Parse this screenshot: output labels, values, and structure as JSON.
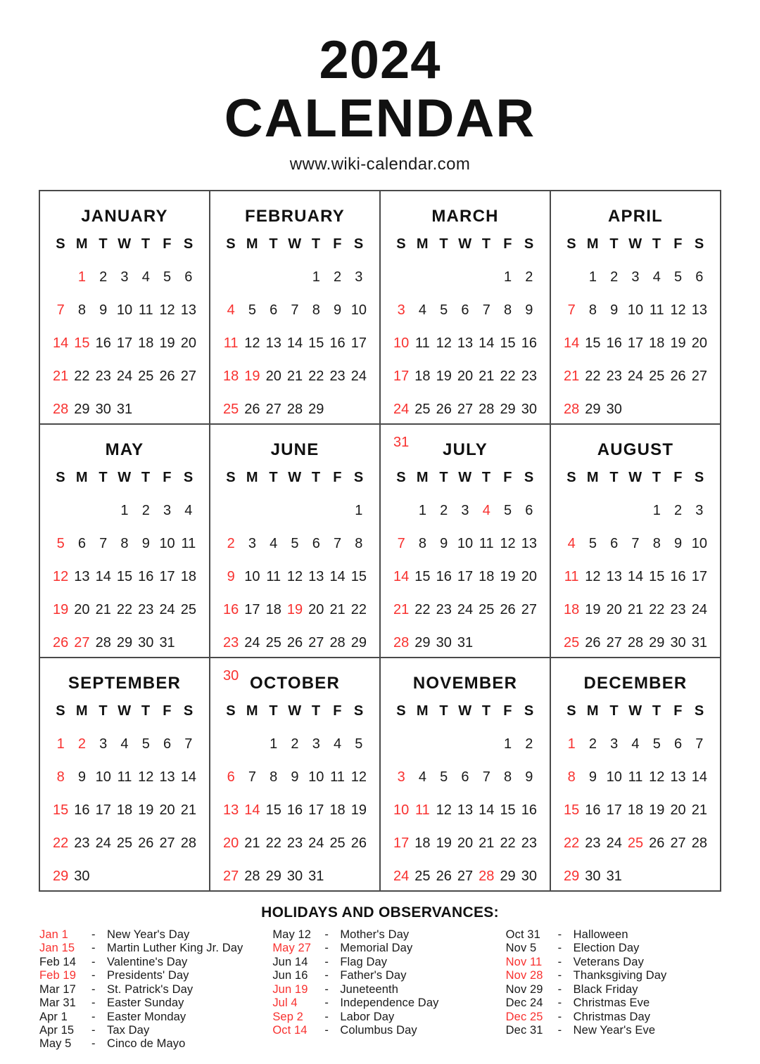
{
  "header": {
    "year": "2024",
    "word": "CALENDAR",
    "site": "www.wiki-calendar.com"
  },
  "colors": {
    "accent_red": "#f8312f",
    "text_black": "#1a1a1a",
    "border": "#4a4a4a"
  },
  "weekday_initials": [
    "S",
    "M",
    "T",
    "W",
    "T",
    "F",
    "S"
  ],
  "chart_data": {
    "type": "table",
    "title": "2024 CALENDAR",
    "months": [
      {
        "name": "JANUARY",
        "lead_blanks": 1,
        "days": 31,
        "red_days": [
          1,
          7,
          14,
          15,
          21,
          28
        ]
      },
      {
        "name": "FEBRUARY",
        "lead_blanks": 4,
        "days": 29,
        "red_days": [
          4,
          11,
          18,
          19,
          25
        ]
      },
      {
        "name": "MARCH",
        "lead_blanks": 5,
        "days": 31,
        "red_days": [
          3,
          10,
          17,
          24,
          31
        ]
      },
      {
        "name": "APRIL",
        "lead_blanks": 1,
        "days": 30,
        "red_days": [
          7,
          14,
          21,
          28
        ]
      },
      {
        "name": "MAY",
        "lead_blanks": 3,
        "days": 31,
        "red_days": [
          5,
          12,
          19,
          26,
          27
        ]
      },
      {
        "name": "JUNE",
        "lead_blanks": 6,
        "days": 30,
        "red_days": [
          2,
          9,
          16,
          19,
          23,
          30
        ]
      },
      {
        "name": "JULY",
        "lead_blanks": 1,
        "days": 31,
        "red_days": [
          4,
          7,
          14,
          21,
          28
        ]
      },
      {
        "name": "AUGUST",
        "lead_blanks": 4,
        "days": 31,
        "red_days": [
          4,
          11,
          18,
          25
        ]
      },
      {
        "name": "SEPTEMBER",
        "lead_blanks": 0,
        "days": 30,
        "red_days": [
          1,
          2,
          8,
          15,
          22,
          29
        ]
      },
      {
        "name": "OCTOBER",
        "lead_blanks": 2,
        "days": 31,
        "red_days": [
          6,
          13,
          14,
          20,
          27
        ]
      },
      {
        "name": "NOVEMBER",
        "lead_blanks": 5,
        "days": 30,
        "red_days": [
          3,
          10,
          11,
          17,
          24,
          28
        ]
      },
      {
        "name": "DECEMBER",
        "lead_blanks": 0,
        "days": 31,
        "red_days": [
          1,
          8,
          15,
          22,
          25,
          29
        ]
      }
    ]
  },
  "holidays": {
    "title": "HOLIDAYS AND OBSERVANCES:",
    "dash": "-",
    "columns": [
      [
        {
          "date": "Jan 1",
          "name": "New Year's Day",
          "red": true
        },
        {
          "date": "Jan 15",
          "name": "Martin Luther King Jr. Day",
          "red": true
        },
        {
          "date": "Feb 14",
          "name": "Valentine's Day",
          "red": false
        },
        {
          "date": "Feb 19",
          "name": "Presidents' Day",
          "red": true
        },
        {
          "date": "Mar 17",
          "name": "St. Patrick's Day",
          "red": false
        },
        {
          "date": "Mar 31",
          "name": "Easter Sunday",
          "red": false
        },
        {
          "date": "Apr 1",
          "name": "Easter Monday",
          "red": false
        },
        {
          "date": "Apr 15",
          "name": "Tax Day",
          "red": false
        },
        {
          "date": "May 5",
          "name": "Cinco de Mayo",
          "red": false
        }
      ],
      [
        {
          "date": "May 12",
          "name": "Mother's Day",
          "red": false
        },
        {
          "date": "May 27",
          "name": "Memorial Day",
          "red": true
        },
        {
          "date": "Jun 14",
          "name": "Flag Day",
          "red": false
        },
        {
          "date": "Jun 16",
          "name": "Father's Day",
          "red": false
        },
        {
          "date": "Jun 19",
          "name": "Juneteenth",
          "red": true
        },
        {
          "date": "Jul 4",
          "name": "Independence Day",
          "red": true
        },
        {
          "date": "Sep 2",
          "name": "Labor Day",
          "red": true
        },
        {
          "date": "Oct 14",
          "name": "Columbus Day",
          "red": true
        }
      ],
      [
        {
          "date": "Oct 31",
          "name": "Halloween",
          "red": false
        },
        {
          "date": "Nov 5",
          "name": "Election Day",
          "red": false
        },
        {
          "date": "Nov 11",
          "name": "Veterans Day",
          "red": true
        },
        {
          "date": "Nov 28",
          "name": "Thanksgiving Day",
          "red": true
        },
        {
          "date": "Nov 29",
          "name": "Black Friday",
          "red": false
        },
        {
          "date": "Dec 24",
          "name": "Christmas Eve",
          "red": false
        },
        {
          "date": "Dec 25",
          "name": "Christmas Day",
          "red": true
        },
        {
          "date": "Dec 31",
          "name": "New Year's Eve",
          "red": false
        }
      ]
    ]
  }
}
